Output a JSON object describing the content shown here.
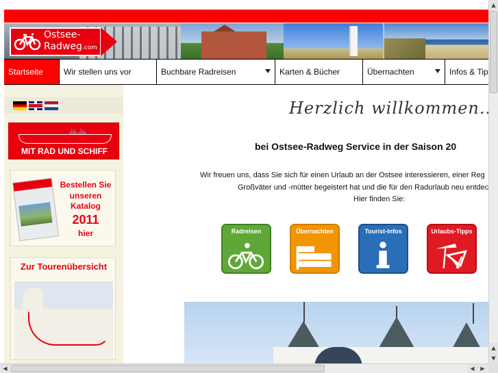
{
  "logo": {
    "line1": "Ostsee-",
    "line2": "Radweg",
    "line2_suffix": ".com"
  },
  "nav": {
    "items": [
      {
        "label": "Startseite",
        "active": true,
        "dropdown": false
      },
      {
        "label": "Wir stellen uns vor",
        "active": false,
        "dropdown": false
      },
      {
        "label": "Buchbare Radreisen",
        "active": false,
        "dropdown": true
      },
      {
        "label": "Karten & Bücher",
        "active": false,
        "dropdown": false
      },
      {
        "label": "Übernachten",
        "active": false,
        "dropdown": true
      },
      {
        "label": "Infos & Tipps",
        "active": false,
        "dropdown": false
      }
    ]
  },
  "sidebar": {
    "languages": [
      "german-flag",
      "english-flag",
      "dutch-flag"
    ],
    "ship_banner": {
      "text": "MIT RAD UND SCHIFF"
    },
    "catalog": {
      "line1": "Bestellen Sie",
      "line2": "unseren",
      "line3": "Katalog",
      "year": "2011",
      "line5": "hier"
    },
    "tour": {
      "title": "Zur Tourenübersicht"
    }
  },
  "main": {
    "script_greeting": "Herzlich willkommen...",
    "headline": "bei Ostsee-Radweg Service in der Saison 20",
    "intro_line1": "Wir freuen uns, dass Sie sich für einen Urlaub an der Ostsee interessieren, einer Reg",
    "intro_line2": "Großväter und -mütter begeistert hat und die für den Radurlaub neu entdec",
    "intro_line3": "Hier finden Sie:",
    "tiles": [
      {
        "label": "Radreisen",
        "icon": "bicycle-icon"
      },
      {
        "label": "Übernachten",
        "icon": "bed-icon"
      },
      {
        "label": "Tourist-Infos",
        "icon": "info-icon"
      },
      {
        "label": "Urlaubs-Tipps",
        "icon": "beach-chair-icon"
      }
    ]
  },
  "colors": {
    "brand_red": "#e8000f",
    "nav_active": "#ff0000",
    "sidebar_bg": "#f5f2e1"
  }
}
